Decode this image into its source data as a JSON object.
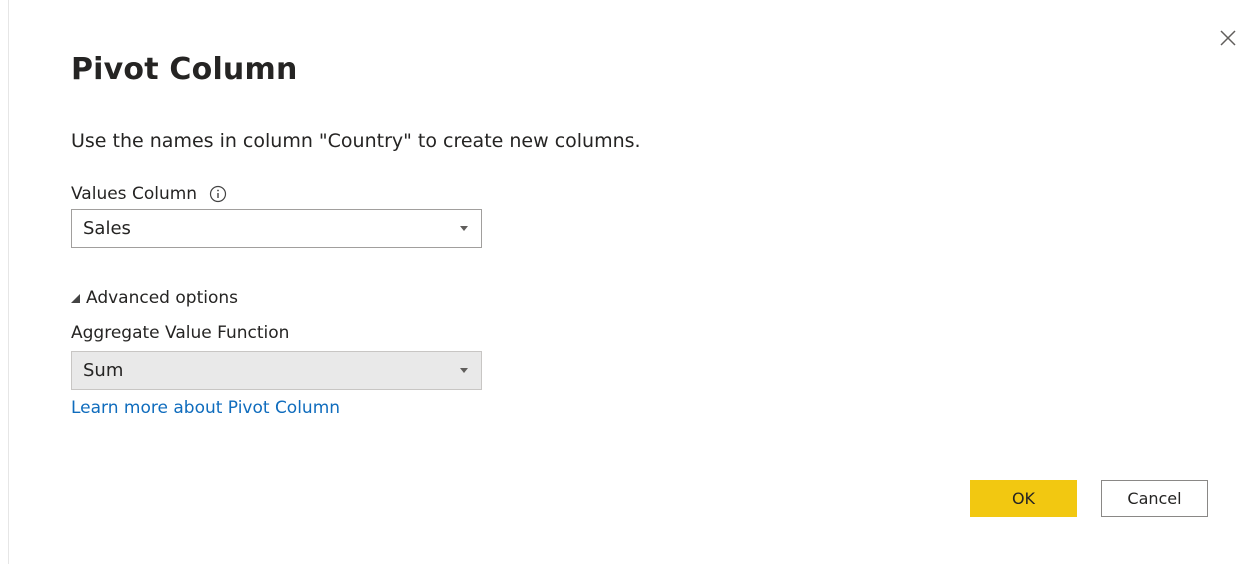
{
  "dialog": {
    "title": "Pivot Column",
    "description": "Use the names in column \"Country\" to create new columns.",
    "values_column": {
      "label": "Values Column",
      "info_icon": "info-icon",
      "selected": "Sales"
    },
    "advanced_options": {
      "label": "Advanced options",
      "expanded": true
    },
    "aggregate_function": {
      "label": "Aggregate Value Function",
      "selected": "Sum"
    },
    "learn_more_link": "Learn more about Pivot Column",
    "buttons": {
      "ok": "OK",
      "cancel": "Cancel"
    },
    "close_icon": "close-icon"
  },
  "colors": {
    "accent": "#f2c811",
    "link": "#0f6cbd",
    "text": "#252423",
    "disabled_bg": "#e9e9e9"
  }
}
